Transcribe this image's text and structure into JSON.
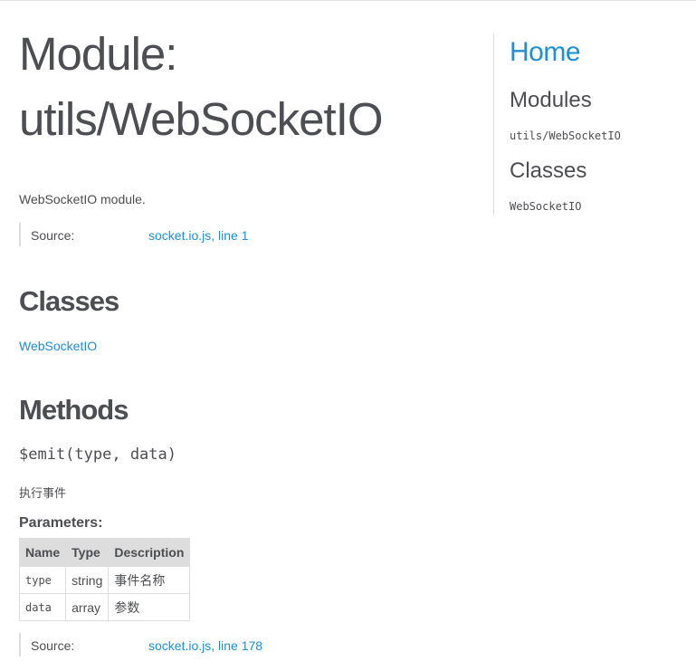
{
  "page": {
    "title_line1": "Module:",
    "title_line2": "utils/WebSocketIO",
    "description": "WebSocketIO module."
  },
  "source_top": {
    "label": "Source:",
    "file": "socket.io.js",
    "separator": ", ",
    "line": "line 1"
  },
  "classes_section": {
    "heading": "Classes",
    "items": [
      "WebSocketIO"
    ]
  },
  "methods_section": {
    "heading": "Methods",
    "method": {
      "signature": "$emit(type, data)",
      "description": "执行事件",
      "params_label": "Parameters:",
      "columns": [
        "Name",
        "Type",
        "Description"
      ],
      "rows": [
        [
          "type",
          "string",
          "事件名称"
        ],
        [
          "data",
          "array",
          "参数"
        ]
      ],
      "source": {
        "label": "Source:",
        "file": "socket.io.js",
        "separator": ", ",
        "line": "line 178"
      }
    }
  },
  "sidebar": {
    "home": "Home",
    "modules_heading": "Modules",
    "modules": [
      "utils/WebSocketIO"
    ],
    "classes_heading": "Classes",
    "classes": [
      "WebSocketIO"
    ]
  },
  "colors": {
    "link": "#1e8ed6",
    "text": "#4d4e53",
    "border": "#dddddd"
  }
}
